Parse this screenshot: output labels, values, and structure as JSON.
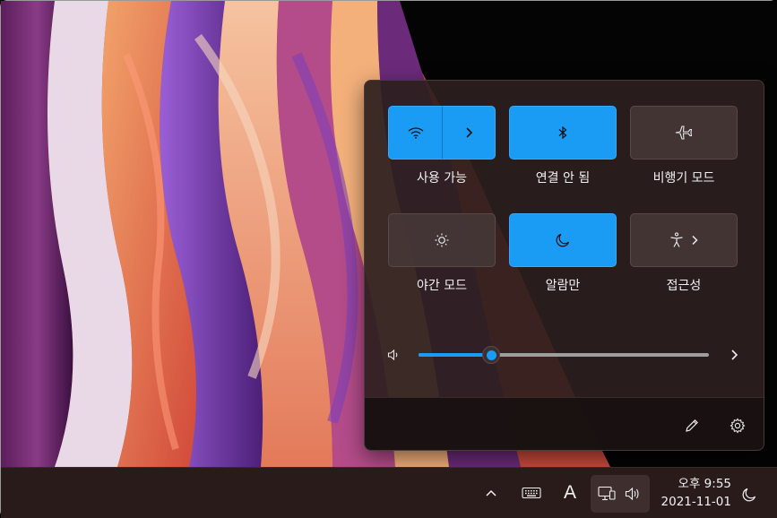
{
  "quick_settings": {
    "tiles": [
      {
        "id": "wifi",
        "label": "사용 가능",
        "state": "on",
        "icon": "wifi-icon",
        "has_chevron": true
      },
      {
        "id": "bluetooth",
        "label": "연결 안 됨",
        "state": "on",
        "icon": "bluetooth-icon"
      },
      {
        "id": "airplane",
        "label": "비행기 모드",
        "state": "off",
        "icon": "airplane-icon"
      },
      {
        "id": "night_light",
        "label": "야간 모드",
        "state": "off",
        "icon": "brightness-icon"
      },
      {
        "id": "focus_assist",
        "label": "알람만",
        "state": "on",
        "icon": "moon-icon"
      },
      {
        "id": "accessibility",
        "label": "접근성",
        "state": "off",
        "icon": "accessibility-icon",
        "has_chevron": true
      }
    ],
    "volume": {
      "level": 0.25,
      "icon": "speaker-icon"
    },
    "footer": {
      "edit_icon": "pencil-icon",
      "settings_icon": "gear-icon"
    }
  },
  "taskbar": {
    "tray_icons": [
      "chevron-up-icon",
      "keyboard-icon",
      "ime-icon",
      "network-icon",
      "speaker-icon"
    ],
    "ime_label": "A",
    "clock": {
      "time": "오후 9:55",
      "date": "2021-11-01"
    },
    "focus_icon": "moon-icon"
  },
  "colors": {
    "accent": "#1a9cf4",
    "flyout_bg": "#2c1e1e",
    "taskbar_bg": "#2a1b1b"
  }
}
